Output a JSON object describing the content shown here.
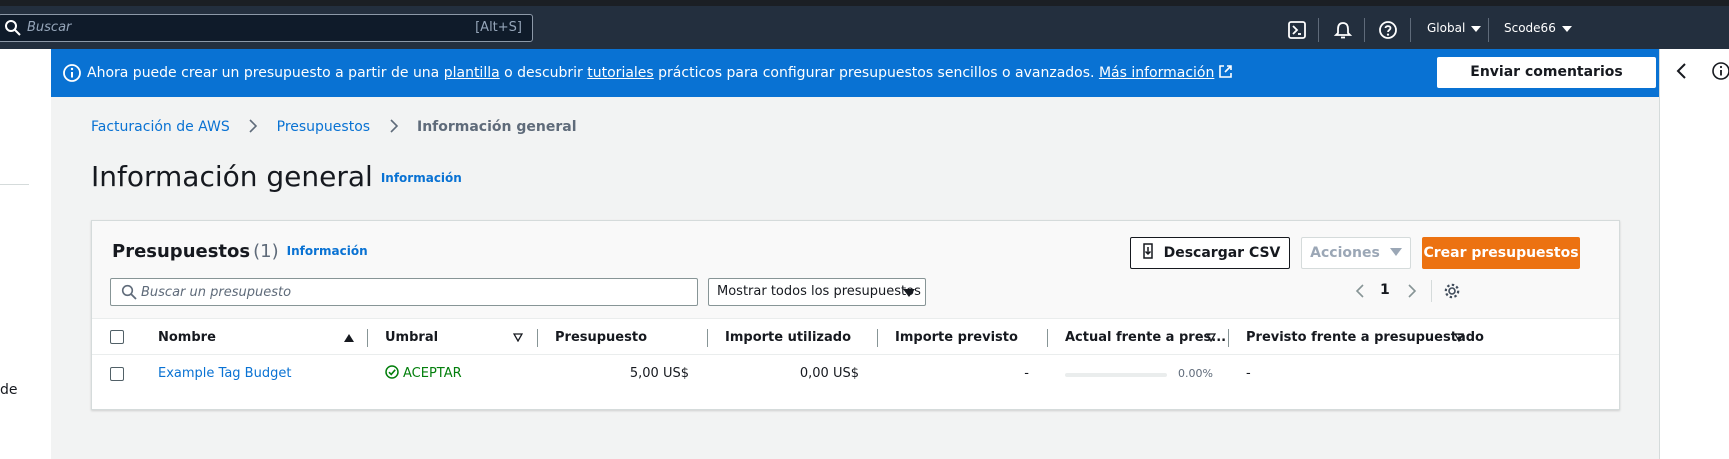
{
  "topbar": {
    "search_placeholder": "Buscar",
    "search_shortcut": "[Alt+S]",
    "region": "Global",
    "user": "Scode66",
    "icons": [
      "cloudshell-icon",
      "notifications-icon",
      "help-icon"
    ]
  },
  "left": {
    "truncated_text": "de"
  },
  "banner": {
    "text_before_1": "Ahora puede crear un presupuesto a partir de una ",
    "link_1": "plantilla",
    "text_between": " o descubrir ",
    "link_2": "tutoriales",
    "text_after": " prácticos para configurar presupuestos sencillos o avanzados. ",
    "link_more": "Más información",
    "feedback_button": "Enviar comentarios",
    "color": "#0972d3"
  },
  "breadcrumb": {
    "items": [
      "Facturación de AWS",
      "Presupuestos"
    ],
    "current": "Información general"
  },
  "page": {
    "title": "Información general",
    "info_link": "Información"
  },
  "budgets": {
    "title": "Presupuestos",
    "count": "(1)",
    "info_link": "Información",
    "download_button": "Descargar CSV",
    "actions_button": "Acciones",
    "create_button": "Crear presupuestos",
    "accent_color": "#ec7211",
    "search_placeholder": "Buscar un presupuesto",
    "filter_value": "Mostrar todos los presupuestos",
    "page_number": "1",
    "columns": [
      "Nombre",
      "Umbral",
      "Presupuesto",
      "Importe utilizado",
      "Importe previsto",
      "Actual frente a pres...",
      "Previsto frente a presupuestado"
    ],
    "rows": [
      {
        "name": "Example Tag Budget",
        "threshold": "ACEPTAR",
        "budget": "5,00 US$",
        "used": "0,00 US$",
        "forecast": "-",
        "actual_vs_budget": "0.00%",
        "actual_vs_budget_fraction": 0.0,
        "forecast_vs_budget": "-"
      }
    ]
  }
}
